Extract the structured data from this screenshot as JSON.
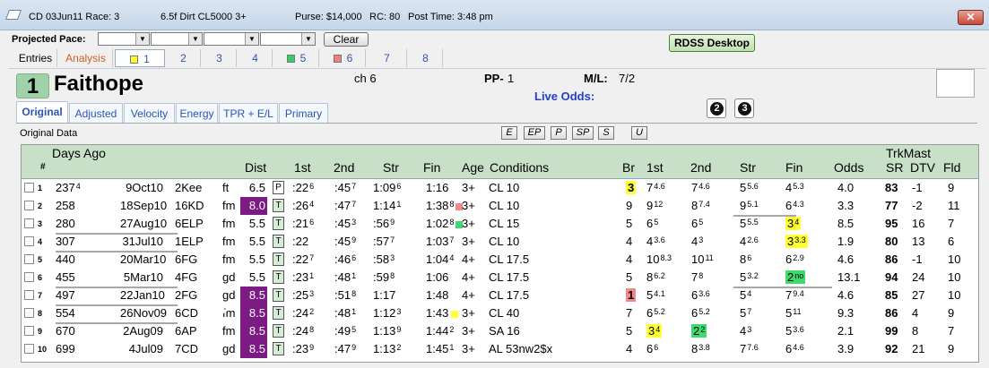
{
  "title": {
    "race": "CD 03Jun11 Race: 3",
    "race_info": "6.5f  Dirt   CL5000  3+",
    "purse": "Purse: $14,000",
    "rc": "RC: 80",
    "post_time": "Post Time: 3:48 pm",
    "close": "✕"
  },
  "pace": {
    "label": "Projected Pace:",
    "clear": "Clear"
  },
  "rdss_label": "RDSS Desktop",
  "tabs": [
    "Entries",
    "Analysis",
    "1",
    "2",
    "3",
    "4",
    "5",
    "6",
    "7",
    "8"
  ],
  "tab_colors": {
    "1": "#ffff33",
    "5": "#33cc66",
    "6": "#f08080"
  },
  "horse": {
    "pp_num": "1",
    "name": "Faithope",
    "sex": "ch 6",
    "pp_label": "PP-",
    "pp_value": "1",
    "ml_label": "M/L:",
    "ml_value": "7/2",
    "live_odds": "Live Odds:"
  },
  "circles": [
    "2",
    "3"
  ],
  "subtabs": [
    "Original",
    "Adjusted",
    "Velocity",
    "Energy",
    "TPR + E/L",
    "Primary"
  ],
  "panel_label": "Original Data",
  "filters": [
    "E",
    "EP",
    "P",
    "SP",
    "S",
    "U"
  ],
  "headers": {
    "days_ago": "Days Ago",
    "num": "#",
    "dist": "Dist",
    "first": "1st",
    "second": "2nd",
    "str": "Str",
    "fin": "Fin",
    "age": "Age",
    "conditions": "Conditions",
    "br": "Br",
    "first2": "1st",
    "second2": "2nd",
    "str2": "Str",
    "fin2": "Fin",
    "odds": "Odds",
    "trkmast": "TrkMast",
    "sr": "SR",
    "dtv": "DTV",
    "fld": "Fld"
  },
  "rows": [
    {
      "n": "1",
      "days": "237",
      "dsup": "4",
      "date": "9Oct10",
      "trk": "2Kee",
      "cond": "ft",
      "dist": "6.5",
      "surf": "P",
      "f1": ":22",
      "f1s": "6",
      "f2": ":45",
      "f2s": "7",
      "st": "1:09",
      "sts": "6",
      "fn": "1:16",
      "fns": "",
      "dot": "",
      "age": "3+",
      "cls": "CL 10",
      "br": "3",
      "brh": "y",
      "c1": "7",
      "c1s": "4.6",
      "c2": "7",
      "c2s": "4.6",
      "cs": "5",
      "css": "5.6",
      "cf": "4",
      "cfs": "5.3",
      "cfh": "",
      "odds": "4.0",
      "sr": "83",
      "dtv": "-1",
      "fld": "9"
    },
    {
      "n": "2",
      "days": "258",
      "dsup": "",
      "date": "18Sep10",
      "trk": "16KD",
      "cond": "fm",
      "dist": "8.0",
      "surf": "T",
      "f1": ":26",
      "f1s": "4",
      "f2": ":47",
      "f2s": "7",
      "st": "1:14",
      "sts": "1",
      "fn": "1:38",
      "fns": "8",
      "dot": "r",
      "age": "3+",
      "cls": "CL 10",
      "br": "9",
      "brh": "",
      "c1": "9",
      "c1s": "12",
      "c2": "8",
      "c2s": "7.4",
      "cs": "9",
      "css": "5.1",
      "cf": "6",
      "cfs": "4.3",
      "cfh": "",
      "odds": "3.3",
      "sr": "77",
      "dtv": "-2",
      "fld": "11"
    },
    {
      "n": "3",
      "days": "280",
      "dsup": "",
      "date": "27Aug10",
      "trk": "6ELP",
      "cond": "fm",
      "dist": "5.5",
      "surf": "T",
      "f1": ":21",
      "f1s": "6",
      "f2": ":45",
      "f2s": "3",
      "st": ":56",
      "sts": "9",
      "fn": "1:02",
      "fns": "8",
      "dot": "g",
      "age": "3+",
      "cls": "CL 15",
      "br": "5",
      "brh": "",
      "c1": "6",
      "c1s": "5",
      "c2": "6",
      "c2s": "5",
      "cs": "5",
      "css": "5.5",
      "cf": "3",
      "cfs": "4",
      "cfh": "y",
      "odds": "8.5",
      "sr": "95",
      "dtv": "16",
      "fld": "7"
    },
    {
      "n": "4",
      "days": "307",
      "dsup": "",
      "date": "31Jul10",
      "trk": "1ELP",
      "cond": "fm",
      "dist": "5.5",
      "surf": "T",
      "f1": ":22",
      "f1s": "",
      "f2": ":45",
      "f2s": "9",
      "st": ":57",
      "sts": "7",
      "fn": "1:03",
      "fns": "7",
      "dot": "",
      "age": "3+",
      "cls": "CL 10",
      "br": "4",
      "brh": "",
      "c1": "4",
      "c1s": "3.6",
      "c2": "4",
      "c2s": "3",
      "cs": "4",
      "css": "2.6",
      "cf": "3",
      "cfs": "3.3",
      "cfh": "y",
      "odds": "1.9",
      "sr": "80",
      "dtv": "13",
      "fld": "6"
    },
    {
      "n": "5",
      "days": "440",
      "dsup": "",
      "date": "20Mar10",
      "trk": "6FG",
      "cond": "fm",
      "dist": "5.5",
      "surf": "T",
      "f1": ":22",
      "f1s": "7",
      "f2": ":46",
      "f2s": "6",
      "st": ":58",
      "sts": "3",
      "fn": "1:04",
      "fns": "4",
      "dot": "",
      "age": "4+",
      "cls": "CL 17.5",
      "br": "4",
      "brh": "",
      "c1": "10",
      "c1s": "8.3",
      "c2": "10",
      "c2s": "11",
      "cs": "8",
      "css": "6",
      "cf": "6",
      "cfs": "2.9",
      "cfh": "",
      "odds": "4.6",
      "sr": "86",
      "dtv": "-1",
      "fld": "10"
    },
    {
      "n": "6",
      "days": "455",
      "dsup": "",
      "date": "5Mar10",
      "trk": "4FG",
      "cond": "gd",
      "dist": "5.5",
      "surf": "T",
      "f1": ":23",
      "f1s": "1",
      "f2": ":48",
      "f2s": "1",
      "st": ":59",
      "sts": "8",
      "fn": "1:06",
      "fns": "",
      "dot": "",
      "age": "4+",
      "cls": "CL 17.5",
      "br": "5",
      "brh": "",
      "c1": "8",
      "c1s": "6.2",
      "c2": "7",
      "c2s": "8",
      "cs": "5",
      "css": "3.2",
      "cf": "2",
      "cfs": "no",
      "cfh": "g",
      "odds": "13.1",
      "sr": "94",
      "dtv": "24",
      "fld": "10"
    },
    {
      "n": "7",
      "days": "497",
      "dsup": "",
      "date": "22Jan10",
      "trk": "2FG",
      "cond": "gd",
      "dist": "8.5",
      "surf": "T",
      "f1": ":25",
      "f1s": "3",
      "f2": ":51",
      "f2s": "8",
      "st": "1:17",
      "sts": "",
      "fn": "1:48",
      "fns": "",
      "dot": "",
      "age": "4+",
      "cls": "CL 17.5",
      "br": "1",
      "brh": "r",
      "c1": "5",
      "c1s": "4.1",
      "c2": "6",
      "c2s": "3.6",
      "cs": "5",
      "css": "4",
      "cf": "7",
      "cfs": "9.4",
      "cfh": "",
      "odds": "4.6",
      "sr": "85",
      "dtv": "27",
      "fld": "10"
    },
    {
      "n": "8",
      "days": "554",
      "dsup": "",
      "date": "26Nov09",
      "trk": "6CD",
      "cond": "fm",
      "dist": "8.5",
      "surf": "T",
      "f1": ":24",
      "f1s": "2",
      "f2": ":48",
      "f2s": "1",
      "st": "1:12",
      "sts": "3",
      "fn": "1:43",
      "fns": "",
      "dot": "y",
      "age": "3+",
      "cls": "CL 40",
      "br": "7",
      "brh": "",
      "c1": "6",
      "c1s": "5.2",
      "c2": "6",
      "c2s": "5.2",
      "cs": "5",
      "css": "7",
      "cf": "5",
      "cfs": "11",
      "cfh": "",
      "odds": "9.3",
      "sr": "86",
      "dtv": "4",
      "fld": "9"
    },
    {
      "n": "9",
      "days": "670",
      "dsup": "",
      "date": "2Aug09",
      "trk": "6AP",
      "cond": "fm",
      "dist": "8.5",
      "surf": "T",
      "f1": ":24",
      "f1s": "8",
      "f2": ":49",
      "f2s": "5",
      "st": "1:13",
      "sts": "9",
      "fn": "1:44",
      "fns": "2",
      "dot": "",
      "age": "3+",
      "cls": "SA 16",
      "br": "5",
      "brh": "",
      "c1": "3",
      "c1s": "4",
      "c1h": "y",
      "c2": "2",
      "c2s": "2",
      "c2h": "g",
      "cs": "4",
      "css": "3",
      "cf": "5",
      "cfs": "3.6",
      "cfh": "",
      "odds": "2.1",
      "sr": "99",
      "dtv": "8",
      "fld": "7"
    },
    {
      "n": "10",
      "days": "699",
      "dsup": "",
      "date": "4Jul09",
      "trk": "7CD",
      "cond": "gd",
      "dist": "8.5",
      "surf": "T",
      "f1": ":23",
      "f1s": "9",
      "f2": ":47",
      "f2s": "9",
      "st": "1:13",
      "sts": "2",
      "fn": "1:45",
      "fns": "1",
      "dot": "",
      "age": "3+",
      "cls": "AL 53nw2$x",
      "br": "4",
      "brh": "",
      "c1": "6",
      "c1s": "6",
      "c2": "8",
      "c2s": "3.8",
      "cs": "7",
      "css": "7.6",
      "cf": "6",
      "cfs": "4.6",
      "cfh": "",
      "odds": "3.9",
      "sr": "92",
      "dtv": "21",
      "fld": "9"
    }
  ]
}
